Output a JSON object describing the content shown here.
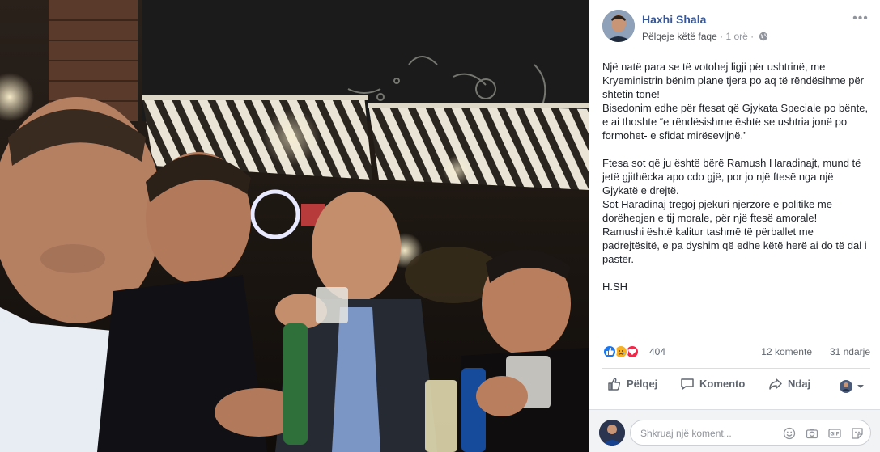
{
  "post": {
    "author": "Haxhi Shala",
    "like_page_label": "Pëlqeje këtë faqe",
    "separator": "·",
    "timestamp": "1 orë",
    "privacy_icon": "globe-icon",
    "more_icon": "more-options-icon",
    "paragraphs": [
      "Një natë para se të votohej ligji për ushtrinë, me Kryeministrin bënim plane tjera po aq të rëndësihme për shtetin tonë!\nBisedonim edhe për ftesat që Gjykata Speciale po bënte, e ai thoshte “e rëndësishme është se ushtria jonë po formohet- e sfidat mirësevijnë.”",
      "Ftesa sot që ju është bërë Ramush Haradinajt, mund të jetë gjithëcka apo cdo gjë, por jo një ftesë nga një Gjykatë e drejtë.\nSot Haradinaj tregoj pjekuri njerzore e politike me dorëheqjen e tij morale, për një ftesë amorale!\nRamushi është kalitur tashmë të përballet me padrejtësitë, e pa dyshim që edhe këtë herë ai do të dal i pastër.",
      "H.SH"
    ]
  },
  "reactions": {
    "icons": [
      "like-reaction-icon",
      "sad-reaction-icon",
      "love-reaction-icon"
    ],
    "count": "404",
    "comments": "12 komente",
    "shares": "31 ndarje"
  },
  "actions": {
    "like_label": "Pëlqej",
    "comment_label": "Komento",
    "share_label": "Ndaj"
  },
  "comment_box": {
    "placeholder": "Shkruaj një koment...",
    "icons": [
      "emoji-icon",
      "camera-icon",
      "gif-icon",
      "sticker-icon"
    ]
  },
  "colors": {
    "author_link": "#365899",
    "secondary_text": "#90949c",
    "like_blue": "#1877f2",
    "love_red": "#f0284a",
    "sad_yellow": "#f7b125"
  }
}
